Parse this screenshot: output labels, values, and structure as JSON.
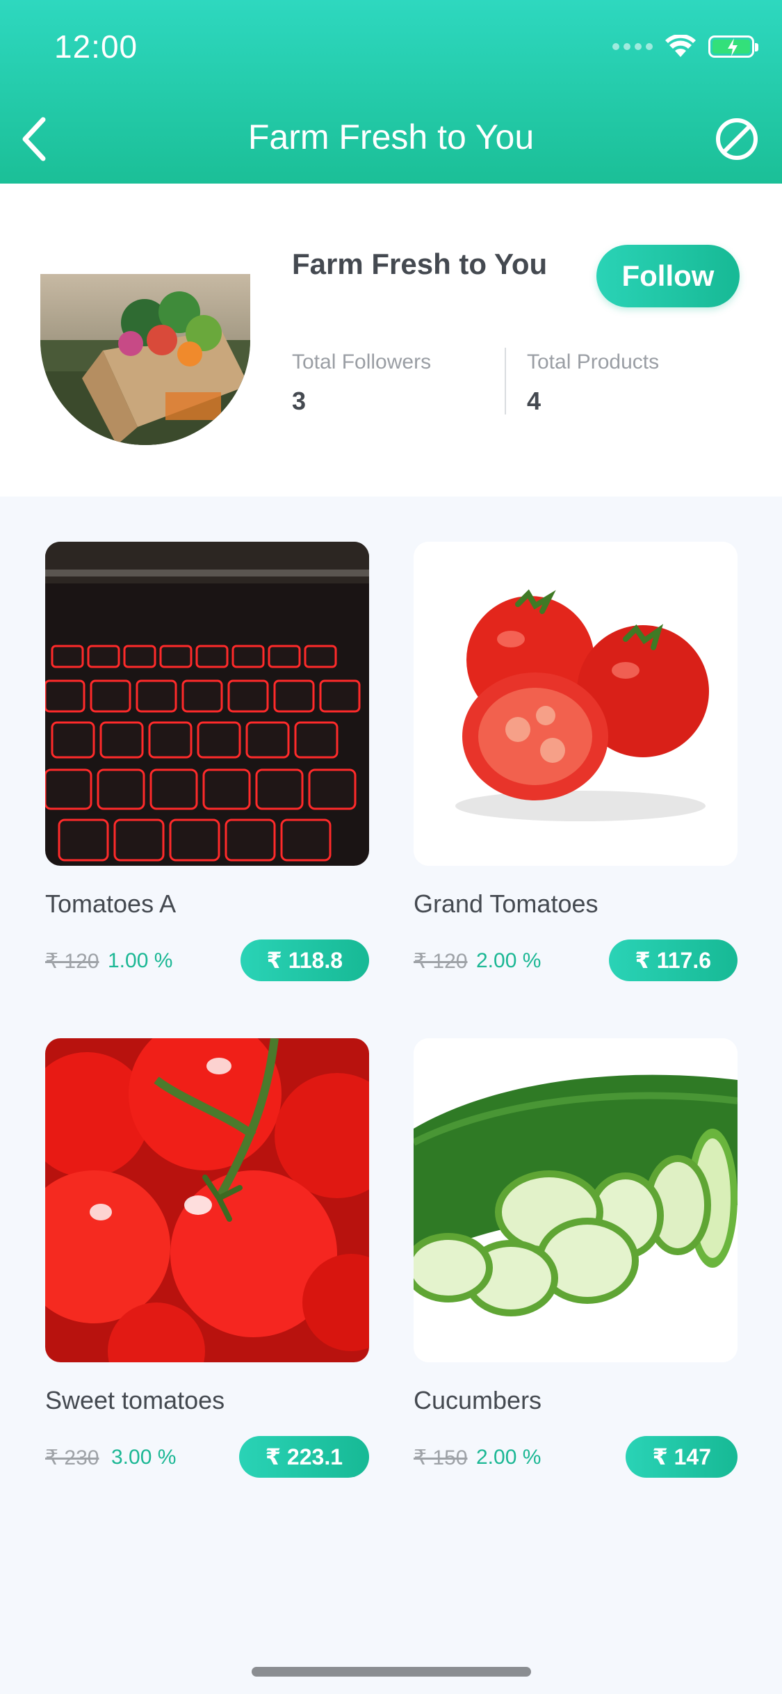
{
  "status_bar": {
    "time": "12:00"
  },
  "nav": {
    "title": "Farm Fresh to You",
    "back_icon": "chevron-left-icon",
    "block_icon": "block-icon"
  },
  "profile": {
    "shop_name": "Farm Fresh to You",
    "follow_label": "Follow",
    "followers_label": "Total Followers",
    "followers_value": "3",
    "products_label": "Total Products",
    "products_value": "4"
  },
  "products": [
    {
      "name": "Tomatoes A",
      "old_price": "₹ 120",
      "discount": "1.00 %",
      "price": "₹ 118.8",
      "image": "red-keyboard-photo"
    },
    {
      "name": "Grand Tomatoes",
      "old_price": "₹ 120",
      "discount": "2.00 %",
      "price": "₹ 117.6",
      "image": "tomatoes-photo"
    },
    {
      "name": "Sweet tomatoes",
      "old_price": "₹ 230",
      "discount": "3.00 %",
      "price": "₹ 223.1",
      "image": "tomato-vine-photo"
    },
    {
      "name": "Cucumbers",
      "old_price": "₹ 150",
      "discount": "2.00 %",
      "price": "₹ 147",
      "image": "cucumber-photo"
    }
  ],
  "colors": {
    "brand_start": "#2ed8bf",
    "brand_end": "#1bbf97",
    "discount": "#1bb794",
    "text_dark": "#444950",
    "text_muted": "#9a9ea4"
  }
}
